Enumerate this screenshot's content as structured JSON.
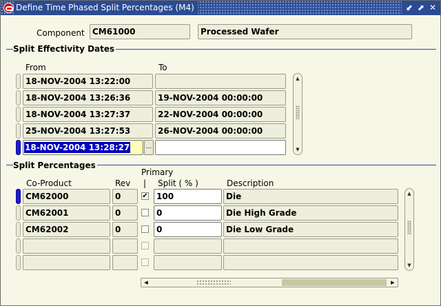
{
  "window": {
    "title": "Define Time Phased Split Percentages (M4)",
    "controls": [
      "⬋",
      "⬈",
      "✕"
    ]
  },
  "component": {
    "label": "Component",
    "code": "CM61000",
    "description": "Processed Wafer"
  },
  "effectivity": {
    "section_title": "Split Effectivity Dates",
    "from_header": "From",
    "to_header": "To",
    "rows": [
      {
        "from": "18-NOV-2004 13:22:00",
        "to": ""
      },
      {
        "from": "18-NOV-2004 13:26:36",
        "to": "19-NOV-2004 00:00:00"
      },
      {
        "from": "18-NOV-2004 13:27:37",
        "to": "22-NOV-2004 00:00:00"
      },
      {
        "from": "25-NOV-2004 13:27:53",
        "to": "26-NOV-2004 00:00:00"
      },
      {
        "from": "18-NOV-2004 13:28:27",
        "to": ""
      }
    ],
    "lov_label": "..."
  },
  "percentages": {
    "section_title": "Split Percentages",
    "headers": {
      "coproduct": "Co-Product",
      "rev": "Rev",
      "primary_line1": "Primary",
      "primary_line2": "|",
      "split": "Split ( % )",
      "description": "Description"
    },
    "rows": [
      {
        "coproduct": "CM62000",
        "rev": "0",
        "primary": "✔",
        "split": "100",
        "description": "Die"
      },
      {
        "coproduct": "CM62001",
        "rev": "0",
        "primary": "",
        "split": "0",
        "description": "Die High Grade"
      },
      {
        "coproduct": "CM62002",
        "rev": "0",
        "primary": "",
        "split": "0",
        "description": "Die Low Grade"
      },
      {
        "coproduct": "",
        "rev": "",
        "primary": "",
        "split": "",
        "description": ""
      },
      {
        "coproduct": "",
        "rev": "",
        "primary": "",
        "split": "",
        "description": ""
      }
    ]
  },
  "scroll": {
    "up": "▲",
    "down": "▼",
    "left": "◀",
    "right": "▶"
  }
}
